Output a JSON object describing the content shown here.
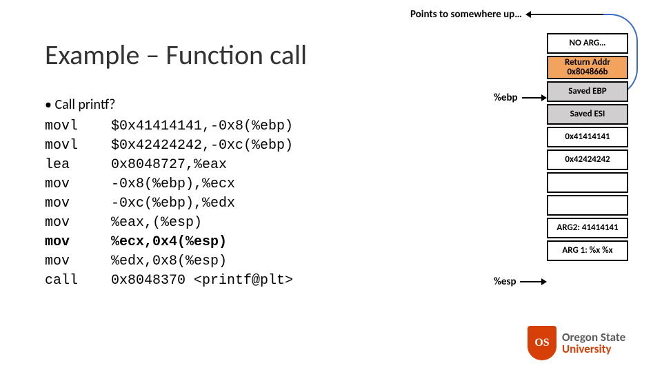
{
  "top_note": "Points to somewhere up…",
  "title": "Example – Function call",
  "bullet": "• Call printf?",
  "asm": [
    {
      "op": "movl",
      "args": "$0x41414141,-0x8(%ebp)",
      "bold": false
    },
    {
      "op": "movl",
      "args": "$0x42424242,-0xc(%ebp)",
      "bold": false
    },
    {
      "op": "lea",
      "args": "0x8048727,%eax",
      "bold": false
    },
    {
      "op": "mov",
      "args": "-0x8(%ebp),%ecx",
      "bold": false
    },
    {
      "op": "mov",
      "args": "-0xc(%ebp),%edx",
      "bold": false
    },
    {
      "op": "mov",
      "args": "%eax,(%esp)",
      "bold": false
    },
    {
      "op": "mov",
      "args": "%ecx,0x4(%esp)",
      "bold": true
    },
    {
      "op": "mov",
      "args": "%edx,0x8(%esp)",
      "bold": false
    },
    {
      "op": "call",
      "args": "0x8048370 <printf@plt>",
      "bold": false
    }
  ],
  "stack": [
    {
      "text": "NO ARG…",
      "cls": ""
    },
    {
      "text": "Return Addr 0x804866b",
      "cls": "orange tall"
    },
    {
      "text": "Saved EBP",
      "cls": "gray"
    },
    {
      "text": "Saved ESI",
      "cls": "gray"
    },
    {
      "text": "0x41414141",
      "cls": ""
    },
    {
      "text": "0x42424242",
      "cls": ""
    },
    {
      "text": "",
      "cls": ""
    },
    {
      "text": "",
      "cls": ""
    },
    {
      "text": "ARG2: 41414141",
      "cls": ""
    },
    {
      "text": "ARG 1: %x %x",
      "cls": ""
    }
  ],
  "pointers": {
    "ebp": "%ebp",
    "esp": "%esp"
  },
  "logo": {
    "shield": "OS",
    "line1": "Oregon State",
    "line2": "University"
  }
}
